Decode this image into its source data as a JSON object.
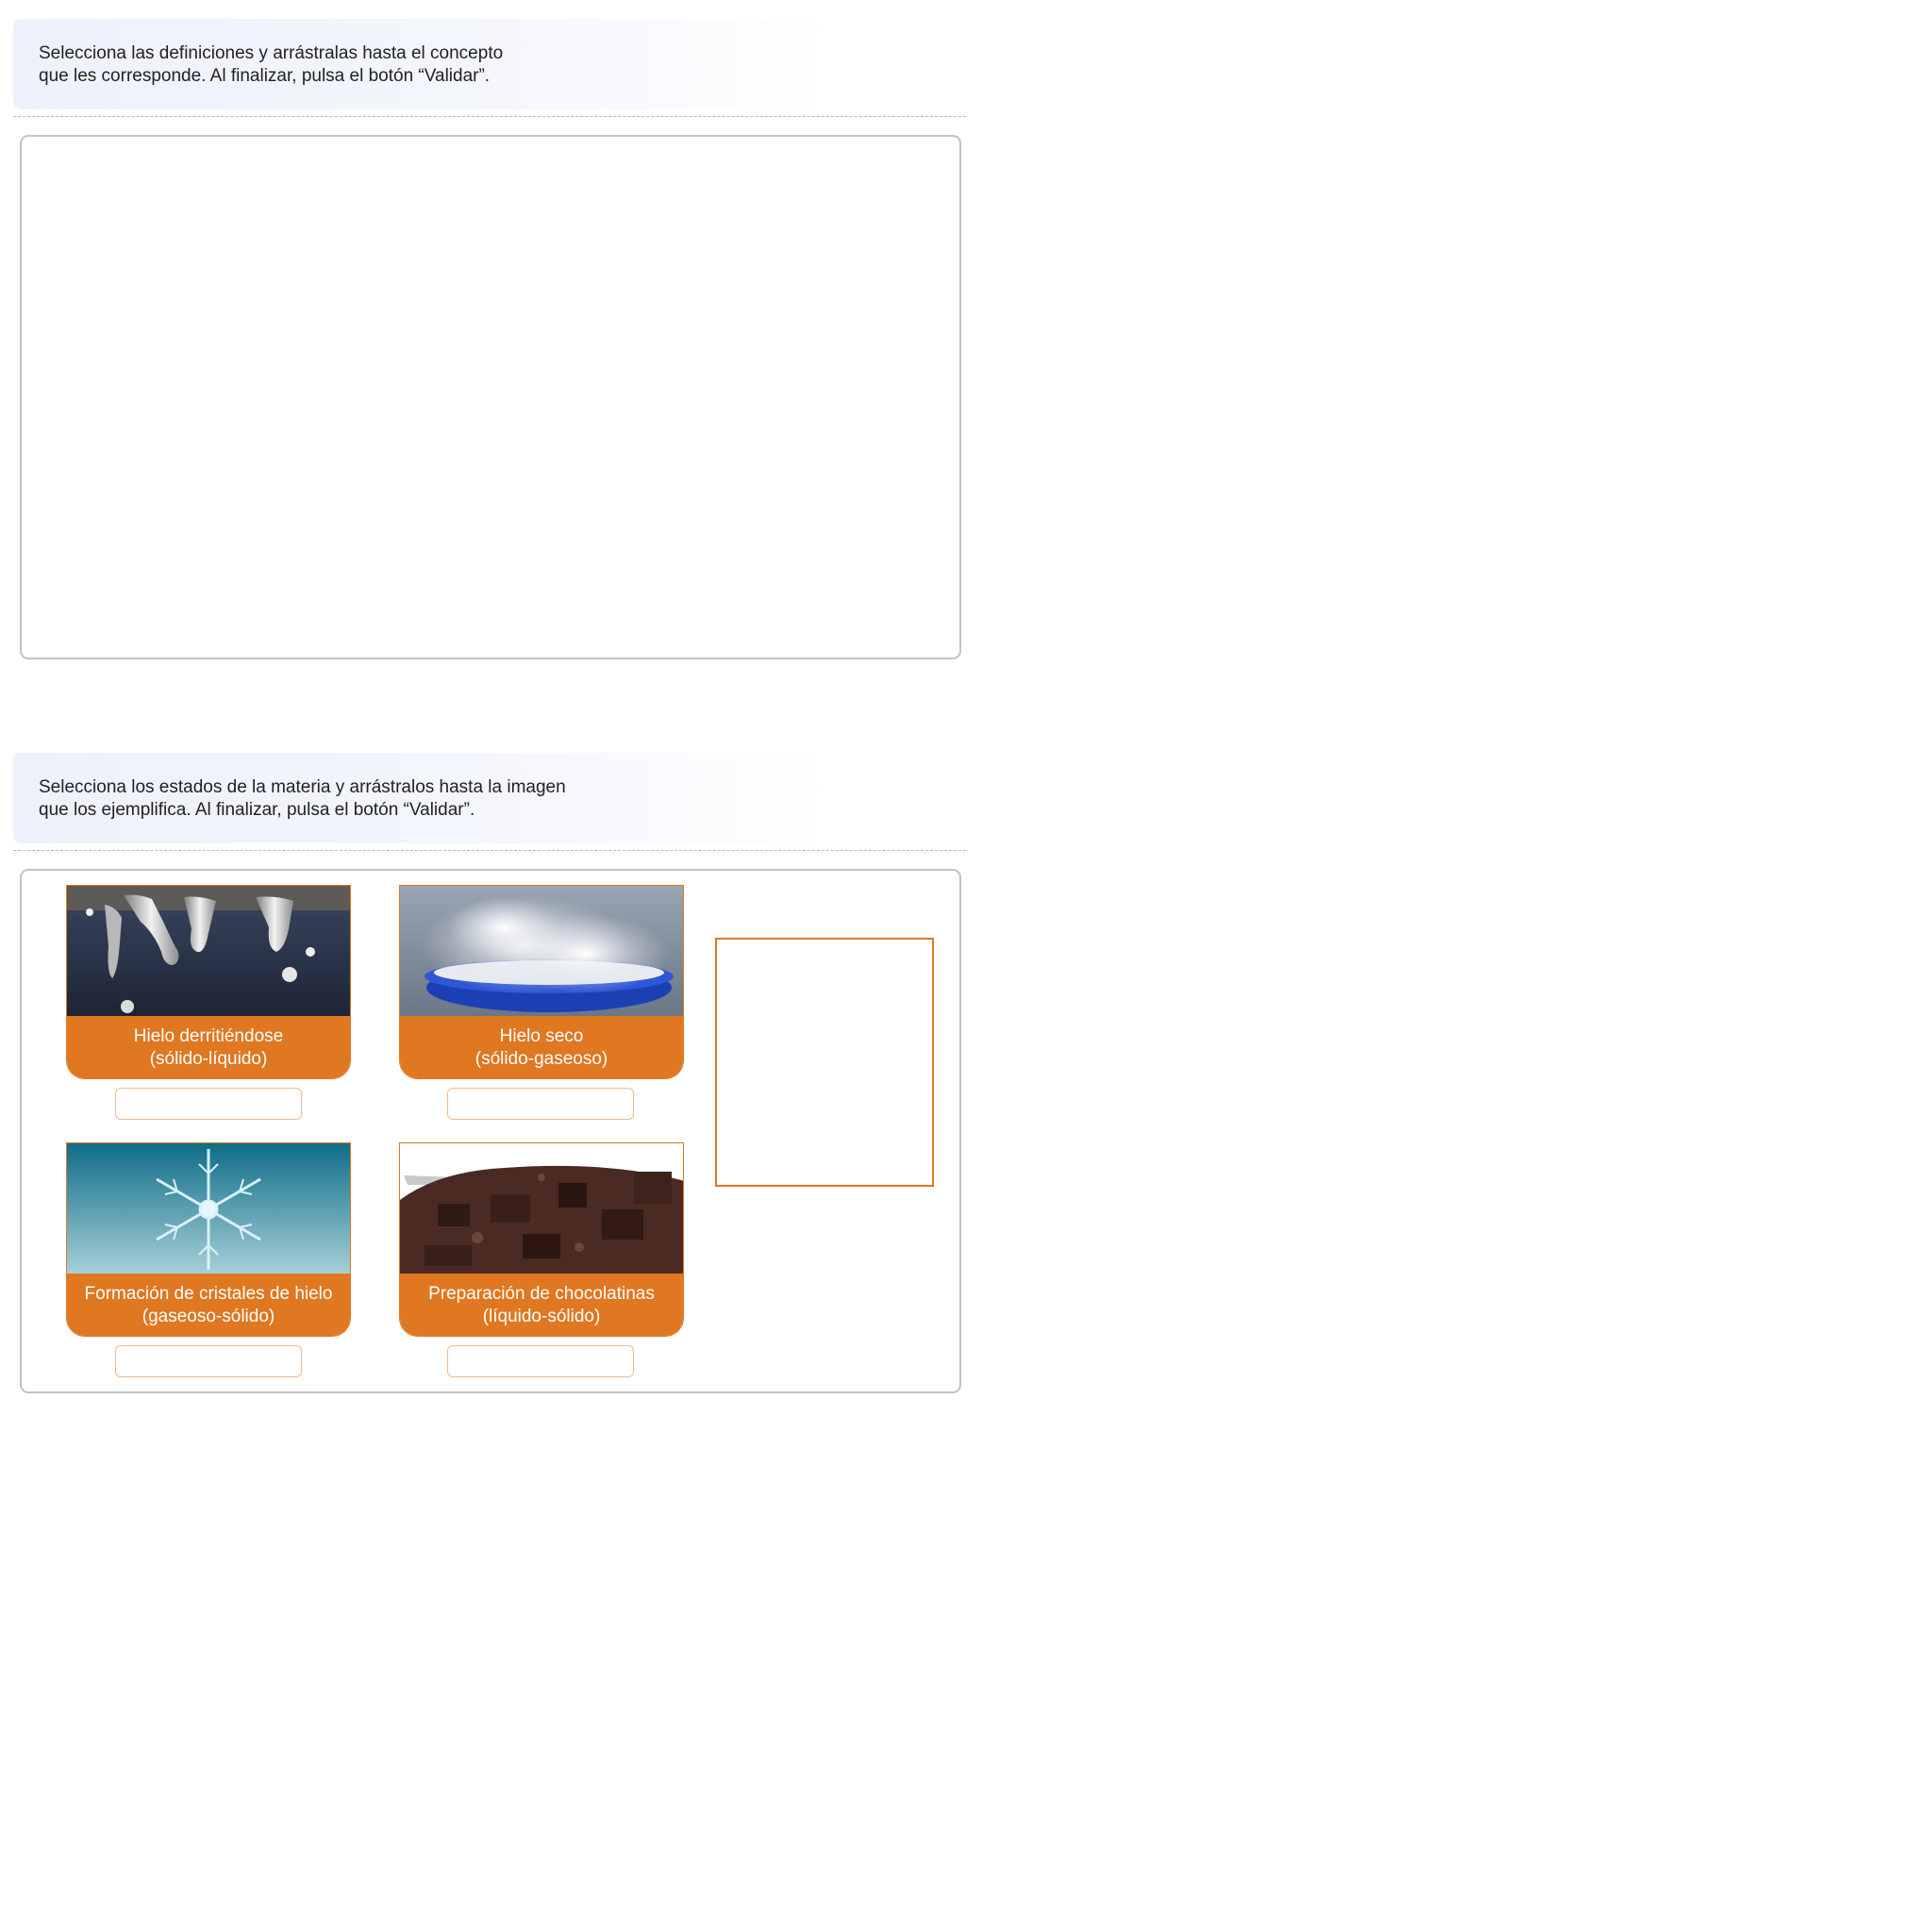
{
  "activity1": {
    "instruction": "Selecciona las definiciones  y arrástralas hasta el concepto\nque les corresponde. Al finalizar, pulsa el botón “Validar”."
  },
  "activity2": {
    "instruction": "Selecciona los estados de la materia y arrástralos hasta la imagen\nque los ejemplifica. Al finalizar, pulsa el botón “Validar”.",
    "cards": [
      {
        "title": "Hielo derritiéndose",
        "subtitle": "(sólido-líquido)",
        "image": "melting-icicles-photo"
      },
      {
        "title": "Hielo seco",
        "subtitle": "(sólido-gaseoso)",
        "image": "dry-ice-bowl-photo"
      },
      {
        "title": "Formación de cristales de hielo",
        "subtitle": "(gaseoso-sólido)",
        "image": "snowflake-crystal-photo"
      },
      {
        "title": "Preparación de chocolatinas",
        "subtitle": "(líquido-sólido)",
        "image": "chopped-chocolate-photo"
      }
    ]
  },
  "colors": {
    "accent": "#e07721",
    "instruction_bg": "#eef1fb",
    "panel_border": "#c2c2c2"
  }
}
